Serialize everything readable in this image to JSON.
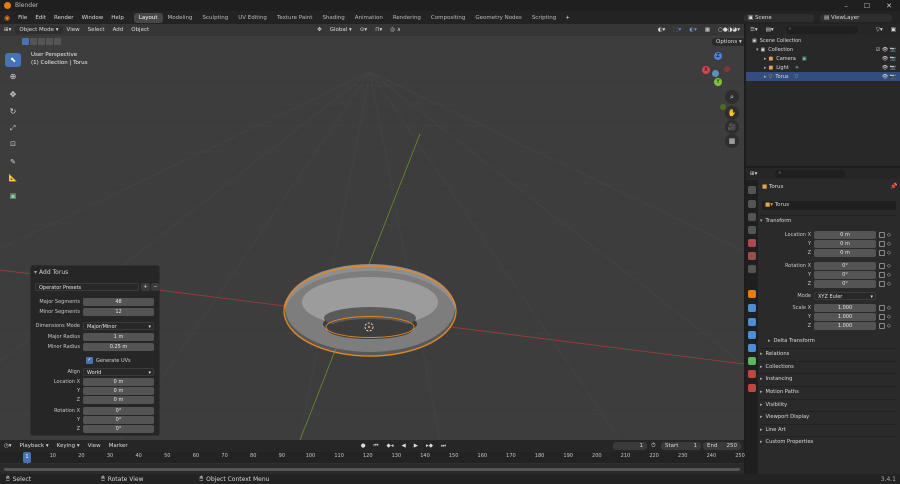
{
  "titlebar": {
    "title": "Blender"
  },
  "menu": [
    "File",
    "Edit",
    "Render",
    "Window",
    "Help"
  ],
  "workspaces": [
    "Layout",
    "Modeling",
    "Sculpting",
    "UV Editing",
    "Texture Paint",
    "Shading",
    "Animation",
    "Rendering",
    "Compositing",
    "Geometry Nodes",
    "Scripting"
  ],
  "active_workspace": "Layout",
  "scene": "Scene",
  "view_layer": "ViewLayer",
  "viewport": {
    "mode": "Object Mode",
    "menus": [
      "View",
      "Select",
      "Add",
      "Object"
    ],
    "orientation": "Global",
    "options": "Options",
    "info_line1": "User Perspective",
    "info_line2": "(1) Collection | Torus"
  },
  "gizmo": {
    "x": "X",
    "y": "Y",
    "z": "Z"
  },
  "operator_panel": {
    "title": "Add Torus",
    "presets": "Operator Presets",
    "major_segments_label": "Major Segments",
    "major_segments": "48",
    "minor_segments_label": "Minor Segments",
    "minor_segments": "12",
    "dimensions_mode_label": "Dimensions Mode",
    "dimensions_mode": "Major/Minor",
    "major_radius_label": "Major Radius",
    "major_radius": "1 m",
    "minor_radius_label": "Minor Radius",
    "minor_radius": "0.25 m",
    "generate_uvs": "Generate UVs",
    "align_label": "Align",
    "align": "World",
    "location_label": "Location X",
    "loc_x": "0 m",
    "loc_y": "0 m",
    "loc_z": "0 m",
    "rotation_label": "Rotation X",
    "rot_x": "0°",
    "rot_y": "0°",
    "rot_z": "0°",
    "y": "Y",
    "z": "Z"
  },
  "outliner": {
    "root": "Scene Collection",
    "collection": "Collection",
    "items": [
      "Camera",
      "Light",
      "Torus"
    ],
    "selected": "Torus"
  },
  "properties": {
    "object_name": "Torus",
    "data_name": "Torus",
    "transform": "Transform",
    "location_x_label": "Location X",
    "loc_x": "0 m",
    "loc_y": "0 m",
    "loc_z": "0 m",
    "rotation_x_label": "Rotation X",
    "rot_x": "0°",
    "rot_y": "0°",
    "rot_z": "0°",
    "mode_label": "Mode",
    "mode": "XYZ Euler",
    "scale_x_label": "Scale X",
    "scale_x": "1.000",
    "scale_y": "1.000",
    "scale_z": "1.000",
    "y": "Y",
    "z": "Z",
    "delta_transform": "Delta Transform",
    "sections": [
      "Relations",
      "Collections",
      "Instancing",
      "Motion Paths",
      "Visibility",
      "Viewport Display",
      "Line Art",
      "Custom Properties"
    ]
  },
  "timeline": {
    "menus": [
      "Playback",
      "Keying",
      "View",
      "Marker"
    ],
    "current_frame": "1",
    "start_label": "Start",
    "start": "1",
    "end_label": "End",
    "end": "250",
    "ticks": [
      "1",
      "10",
      "20",
      "30",
      "40",
      "50",
      "60",
      "70",
      "80",
      "90",
      "100",
      "110",
      "120",
      "130",
      "140",
      "150",
      "160",
      "170",
      "180",
      "190",
      "200",
      "210",
      "220",
      "230",
      "240",
      "250"
    ]
  },
  "statusbar": {
    "select": "Select",
    "rotate": "Rotate View",
    "context": "Object Context Menu",
    "version": "3.4.1"
  },
  "colors": {
    "accent": "#4772b3",
    "selection": "#e87d0d",
    "viewport_bg": "#3d3d3d",
    "x_axis": "#c23c3c",
    "y_axis": "#7eab2d"
  }
}
